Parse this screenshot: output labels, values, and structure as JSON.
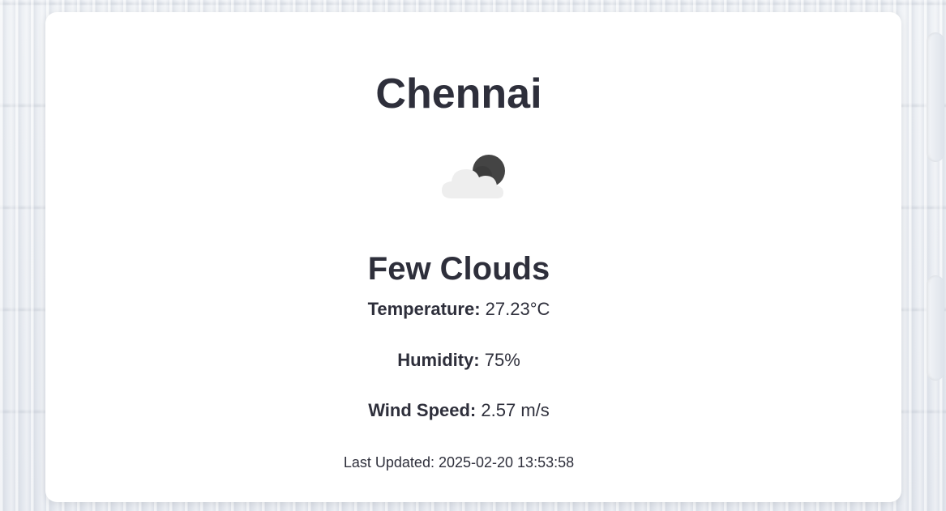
{
  "weather": {
    "city": "Chennai",
    "icon": "few-clouds-night-icon",
    "condition": "Few Clouds",
    "temperature_label": "Temperature:",
    "temperature_value": "27.23°C",
    "humidity_label": "Humidity:",
    "humidity_value": "75%",
    "wind_label": "Wind Speed:",
    "wind_value": "2.57 m/s",
    "updated_label": "Last Updated:",
    "updated_value": "2025-02-20 13:53:58"
  },
  "colors": {
    "text": "#2e2f3b",
    "card": "#ffffff",
    "cloud": "#eeeeee",
    "moon": "#444444"
  }
}
